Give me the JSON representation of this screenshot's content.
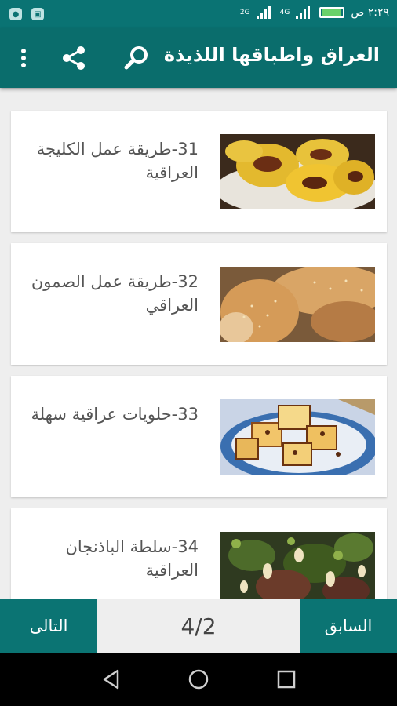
{
  "status_bar": {
    "time": "٢:٢٩ ص",
    "net1": "2G",
    "net2": "4G",
    "background": "#0a7373"
  },
  "app_bar": {
    "title": "العراق واطباقها اللذيذة",
    "icons": [
      "search-icon",
      "share-icon",
      "overflow-menu-icon"
    ],
    "color": "#0a6d6c"
  },
  "recipes": [
    {
      "title": "31-طريقة عمل الكليجة العراقية",
      "image": "kleicha-cookies"
    },
    {
      "title": "32-طريقة عمل الصمون العراقي",
      "image": "samoon-bread"
    },
    {
      "title": "33-حلويات عراقية سهلة",
      "image": "iraqi-sweets"
    },
    {
      "title": "34-سلطة الباذنجان العراقية",
      "image": "eggplant-salad"
    }
  ],
  "pager": {
    "next_label": "التالى",
    "prev_label": "السابق",
    "page": "4/2",
    "accent": "#0b7473"
  },
  "system_nav": {
    "icons": [
      "back-icon",
      "home-icon",
      "recents-icon"
    ]
  }
}
